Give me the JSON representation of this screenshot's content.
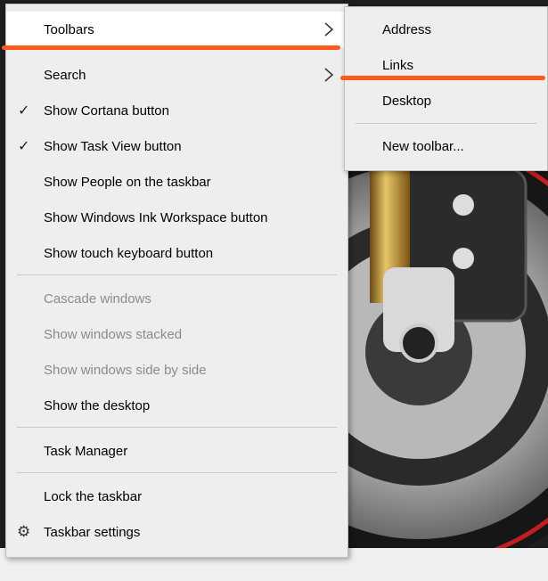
{
  "context_menu": {
    "items": [
      {
        "label": "Toolbars",
        "checked": false,
        "disabled": false,
        "submenu": true
      },
      {
        "label": "Search",
        "checked": false,
        "disabled": false,
        "submenu": true
      },
      {
        "label": "Show Cortana button",
        "checked": true,
        "disabled": false,
        "submenu": false
      },
      {
        "label": "Show Task View button",
        "checked": true,
        "disabled": false,
        "submenu": false
      },
      {
        "label": "Show People on the taskbar",
        "checked": false,
        "disabled": false,
        "submenu": false
      },
      {
        "label": "Show Windows Ink Workspace button",
        "checked": false,
        "disabled": false,
        "submenu": false
      },
      {
        "label": "Show touch keyboard button",
        "checked": false,
        "disabled": false,
        "submenu": false
      },
      {
        "label": "Cascade windows",
        "checked": false,
        "disabled": true,
        "submenu": false
      },
      {
        "label": "Show windows stacked",
        "checked": false,
        "disabled": true,
        "submenu": false
      },
      {
        "label": "Show windows side by side",
        "checked": false,
        "disabled": true,
        "submenu": false
      },
      {
        "label": "Show the desktop",
        "checked": false,
        "disabled": false,
        "submenu": false
      },
      {
        "label": "Task Manager",
        "checked": false,
        "disabled": false,
        "submenu": false
      },
      {
        "label": "Lock the taskbar",
        "checked": false,
        "disabled": false,
        "submenu": false
      },
      {
        "label": "Taskbar settings",
        "checked": false,
        "disabled": false,
        "submenu": false,
        "icon": "gear-icon"
      }
    ]
  },
  "toolbars_submenu": {
    "items": [
      {
        "label": "Address"
      },
      {
        "label": "Links"
      },
      {
        "label": "Desktop"
      },
      {
        "label": "New toolbar..."
      }
    ]
  },
  "colors": {
    "menu_bg": "#eeeeee",
    "highlight": "#ffffff",
    "disabled_text": "#8b8b8b",
    "annotation": "#ff5a1a"
  }
}
